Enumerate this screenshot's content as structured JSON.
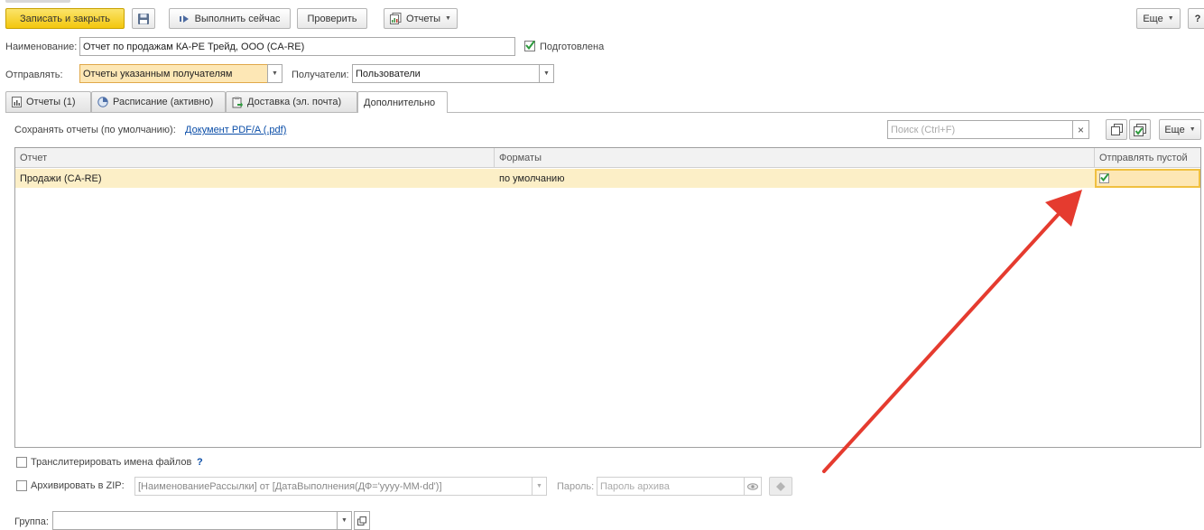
{
  "toolbar": {
    "save_close": "Записать и закрыть",
    "run_now": "Выполнить сейчас",
    "check": "Проверить",
    "reports": "Отчеты",
    "more": "Еще",
    "help": "?"
  },
  "form": {
    "name_label": "Наименование:",
    "name_value": "Отчет по продажам КА-РЕ Трейд, ООО (CA-RE)",
    "prepared_label": "Подготовлена",
    "prepared_checked": true,
    "send_label": "Отправлять:",
    "send_value": "Отчеты указанным получателям",
    "recipients_label": "Получатели:",
    "recipients_value": "Пользователи"
  },
  "tabs": [
    {
      "label": "Отчеты (1)",
      "icon": "report-icon",
      "active": false
    },
    {
      "label": "Расписание (активно)",
      "icon": "schedule-icon",
      "active": false
    },
    {
      "label": "Доставка (эл. почта)",
      "icon": "delivery-icon",
      "active": false
    },
    {
      "label": "Дополнительно",
      "icon": "",
      "active": true
    }
  ],
  "panel": {
    "save_default_label": "Сохранять отчеты (по умолчанию):",
    "save_default_link": "Документ PDF/A (.pdf)",
    "search_placeholder": "Поиск (Ctrl+F)",
    "search_clear": "×",
    "more": "Еще"
  },
  "table": {
    "columns": [
      "Отчет",
      "Форматы",
      "Отправлять пустой"
    ],
    "rows": [
      {
        "report": "Продажи (CA-RE)",
        "formats": "по умолчанию",
        "send_empty": true
      }
    ]
  },
  "bottom": {
    "transliterate_label": "Транслитерировать имена файлов",
    "transliterate_help": "?",
    "zip_label": "Архивировать в ZIP:",
    "zip_name": "[НаименованиеРассылки] от [ДатаВыполнения(ДФ='yyyy-MM-dd')]",
    "password_label": "Пароль:",
    "password_placeholder": "Пароль архива",
    "group_label": "Группа:",
    "group_value": ""
  },
  "colors": {
    "accent_yellow": "#f3c70d",
    "selected_row": "#fcefc7",
    "arrow_red": "#e53b2f",
    "link_blue": "#0b4ea8",
    "check_green": "#2e9a3e"
  }
}
